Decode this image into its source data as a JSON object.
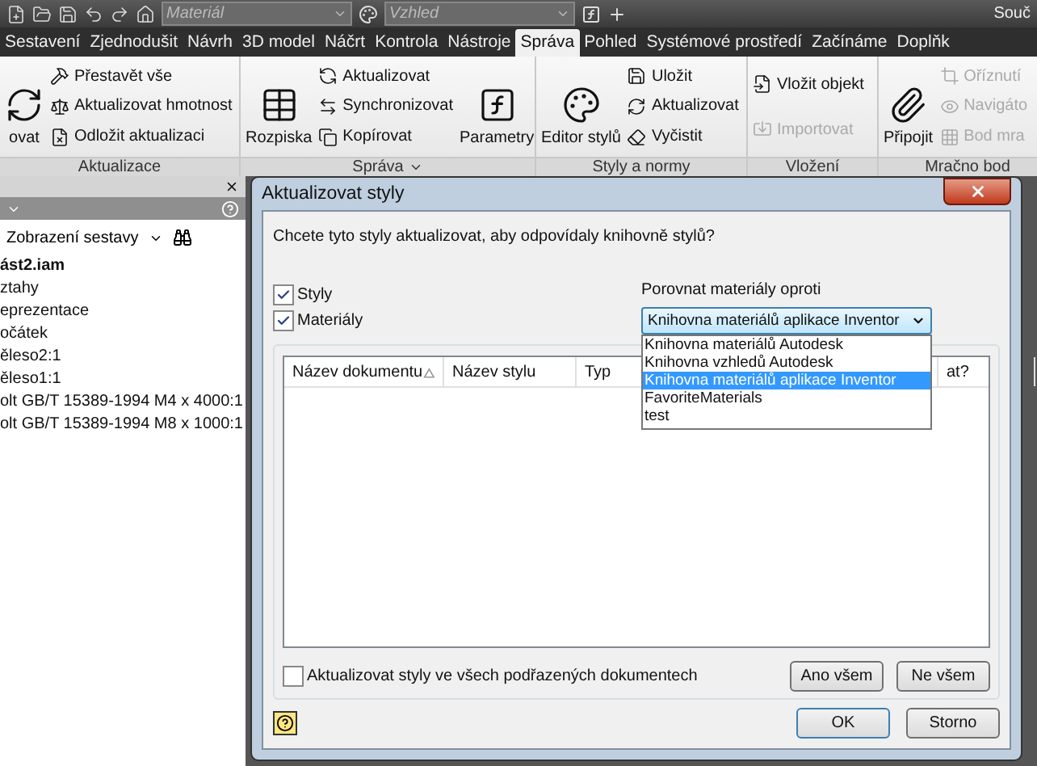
{
  "app": {
    "material_combo": {
      "placeholder": "Materiál"
    },
    "appearance_combo": {
      "placeholder": "Vzhled"
    },
    "title": "Souč"
  },
  "tabs": [
    {
      "label": "Sestavení",
      "selected": false
    },
    {
      "label": "Zjednodušit",
      "selected": false
    },
    {
      "label": "Návrh",
      "selected": false
    },
    {
      "label": "3D model",
      "selected": false
    },
    {
      "label": "Náčrt",
      "selected": false
    },
    {
      "label": "Kontrola",
      "selected": false
    },
    {
      "label": "Nástroje",
      "selected": false
    },
    {
      "label": "Správa",
      "selected": true
    },
    {
      "label": "Pohled",
      "selected": false
    },
    {
      "label": "Systémové prostředí",
      "selected": false
    },
    {
      "label": "Začínáme",
      "selected": false
    },
    {
      "label": "Doplňk",
      "selected": false
    }
  ],
  "ribbon": {
    "groups": [
      {
        "label": "Aktualizace",
        "has_menu": false,
        "tools": [
          {
            "kind": "large",
            "label": "ovat",
            "disabled": false
          },
          {
            "kind": "small",
            "label": "Přestavět vše",
            "disabled": false
          },
          {
            "kind": "small",
            "label": "Aktualizovat hmotnost",
            "disabled": false
          },
          {
            "kind": "small",
            "label": "Odložit aktualizaci",
            "disabled": false
          }
        ]
      },
      {
        "label": "Správa",
        "has_menu": true,
        "tools": [
          {
            "kind": "large",
            "label": "Rozpiska",
            "disabled": false
          },
          {
            "kind": "small",
            "label": "Aktualizovat",
            "disabled": false
          },
          {
            "kind": "small",
            "label": "Synchronizovat",
            "disabled": false
          },
          {
            "kind": "small",
            "label": "Kopírovat",
            "disabled": false
          },
          {
            "kind": "large",
            "label": "Parametry",
            "disabled": false
          }
        ]
      },
      {
        "label": "Styly a normy",
        "has_menu": false,
        "tools": [
          {
            "kind": "large",
            "label": "Editor stylů",
            "disabled": false
          },
          {
            "kind": "small",
            "label": "Uložit",
            "disabled": false
          },
          {
            "kind": "small",
            "label": "Aktualizovat",
            "disabled": false
          },
          {
            "kind": "small",
            "label": "Vyčistit",
            "disabled": false
          }
        ]
      },
      {
        "label": "Vložení",
        "has_menu": false,
        "tools": [
          {
            "kind": "small",
            "label": "Vložit objekt",
            "disabled": false
          },
          {
            "kind": "small",
            "label": "Importovat",
            "disabled": true
          }
        ]
      },
      {
        "label": "Mračno bod",
        "has_menu": false,
        "tools": [
          {
            "kind": "large",
            "label": "Připojit",
            "disabled": false
          },
          {
            "kind": "small",
            "label": "Oříznutí",
            "disabled": true
          },
          {
            "kind": "small",
            "label": "Navigáto",
            "disabled": true
          },
          {
            "kind": "small",
            "label": "Bod mra",
            "disabled": true
          }
        ]
      }
    ]
  },
  "browser": {
    "view_label": "Zobrazení sestavy",
    "tree": {
      "label": "ást2.iam",
      "children": [
        {
          "label": "ztahy"
        },
        {
          "label": "eprezentace"
        },
        {
          "label": "očátek"
        },
        {
          "label": "ěleso2:1"
        },
        {
          "label": "ěleso1:1"
        },
        {
          "label": "olt GB/T 15389-1994 M4 x 4000:1"
        },
        {
          "label": "olt GB/T 15389-1994 M8 x 1000:1"
        }
      ]
    }
  },
  "dialog": {
    "title": "Aktualizovat styly",
    "question": "Chcete tyto styly aktualizovat, aby odpovídaly knihovně stylů?",
    "checkboxes": [
      {
        "label": "Styly",
        "checked": true
      },
      {
        "label": "Materiály",
        "checked": true
      }
    ],
    "compare": {
      "label": "Porovnat materiály oproti",
      "value": "Knihovna materiálů aplikace Inventor",
      "expanded": true,
      "options": [
        {
          "label": "Knihovna materiálů Autodesk",
          "selected": false
        },
        {
          "label": "Knihovna vzhledů Autodesk",
          "selected": false
        },
        {
          "label": "Knihovna materiálů aplikace Inventor",
          "selected": true
        },
        {
          "label": "FavoriteMaterials",
          "selected": false
        },
        {
          "label": "test",
          "selected": false
        }
      ]
    },
    "table": {
      "columns": [
        {
          "label": "Název dokumentu",
          "sorted": true
        },
        {
          "label": "Název stylu",
          "sorted": false
        },
        {
          "label": "Typ",
          "sorted": false
        },
        {
          "label": "at?",
          "sorted": false
        }
      ]
    },
    "update_children": {
      "label": "Aktualizovat styly ve všech podřazených dokumentech",
      "checked": false
    },
    "buttons": [
      {
        "label": "Ano všem",
        "default": false
      },
      {
        "label": "Ne všem",
        "default": false
      }
    ],
    "footer_buttons": [
      {
        "label": "OK",
        "default": true
      },
      {
        "label": "Storno",
        "default": false
      }
    ]
  }
}
